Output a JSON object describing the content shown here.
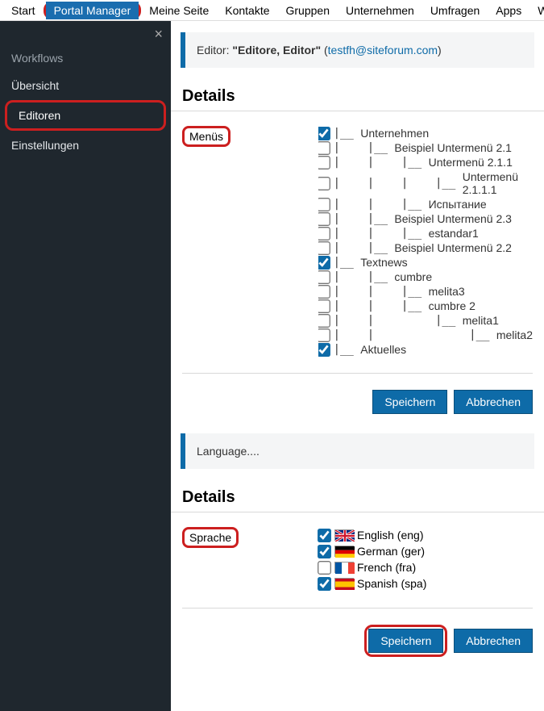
{
  "topnav": {
    "items": [
      "Start",
      "Portal Manager",
      "Meine Seite",
      "Kontakte",
      "Gruppen",
      "Unternehmen",
      "Umfragen",
      "Apps",
      "We"
    ],
    "activeIndex": 1
  },
  "sidebar": {
    "title": "Workflows",
    "items": [
      "Übersicht",
      "Editoren",
      "Einstellungen"
    ],
    "activeIndex": 1
  },
  "editor_bar": {
    "prefix": "Editor:",
    "name": "\"Editore, Editor\"",
    "email": "testfh@siteforum.com"
  },
  "details_heading": "Details",
  "menus_label": "Menüs",
  "menu_items": [
    {
      "checked": true,
      "indent": "|__ ",
      "label": "Unternehmen"
    },
    {
      "checked": false,
      "indent": "|    |__ ",
      "label": "Beispiel Untermenü 2.1"
    },
    {
      "checked": false,
      "indent": "|    |    |__ ",
      "label": "Untermenü 2.1.1"
    },
    {
      "checked": false,
      "indent": "|    |    |    |__ ",
      "label": "Untermenü 2.1.1.1"
    },
    {
      "checked": false,
      "indent": "|    |    |__ ",
      "label": "Испытание"
    },
    {
      "checked": false,
      "indent": "|    |__ ",
      "label": "Beispiel Untermenü 2.3"
    },
    {
      "checked": false,
      "indent": "|    |    |__ ",
      "label": "estandar1"
    },
    {
      "checked": false,
      "indent": "|    |__ ",
      "label": "Beispiel Untermenü 2.2"
    },
    {
      "checked": true,
      "indent": "|__ ",
      "label": "Textnews"
    },
    {
      "checked": false,
      "indent": "|    |__ ",
      "label": "cumbre"
    },
    {
      "checked": false,
      "indent": "|    |    |__ ",
      "label": "melita3"
    },
    {
      "checked": false,
      "indent": "|    |    |__ ",
      "label": "cumbre 2"
    },
    {
      "checked": false,
      "indent": "|    |         |__ ",
      "label": "melita1"
    },
    {
      "checked": false,
      "indent": "|    |              |__ ",
      "label": "melita2"
    },
    {
      "checked": true,
      "indent": "|__ ",
      "label": "Aktuelles"
    }
  ],
  "buttons": {
    "save": "Speichern",
    "cancel": "Abbrechen"
  },
  "language_bar": "Language....",
  "sprache_label": "Sprache",
  "languages": [
    {
      "checked": true,
      "label": "English (eng)",
      "flag": "uk"
    },
    {
      "checked": true,
      "label": "German (ger)",
      "flag": "de"
    },
    {
      "checked": false,
      "label": "French (fra)",
      "flag": "fr"
    },
    {
      "checked": true,
      "label": "Spanish (spa)",
      "flag": "es"
    }
  ]
}
